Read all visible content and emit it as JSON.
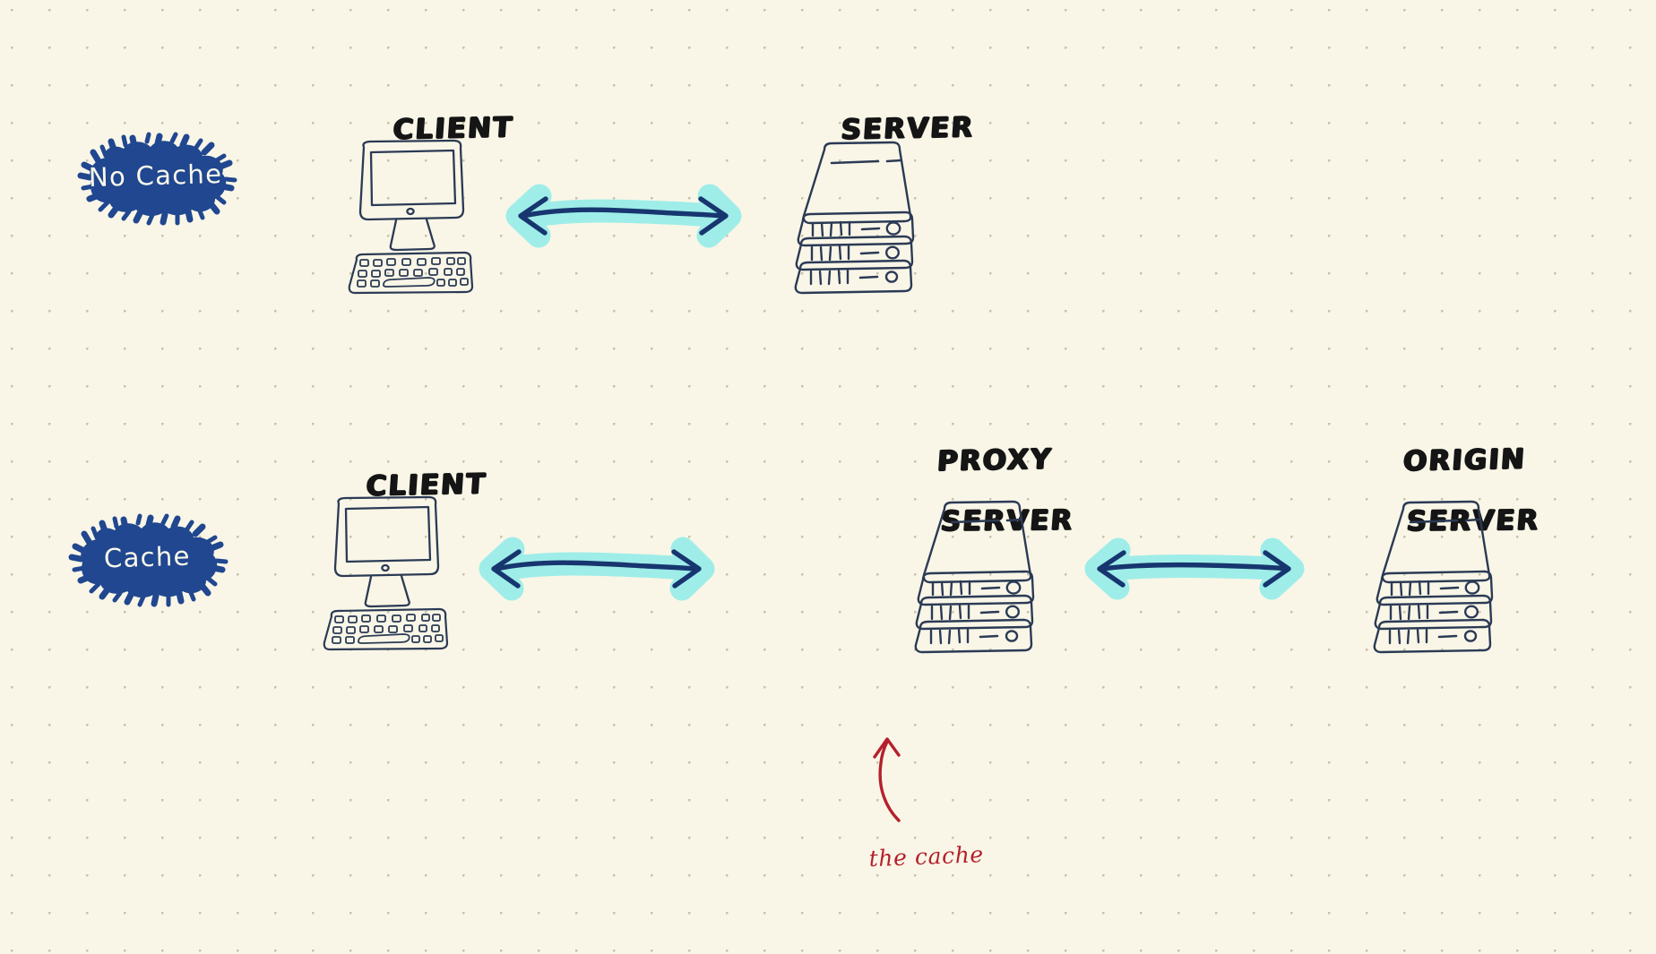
{
  "page": {
    "title": "Cache vs No Cache network diagram",
    "background_color": "#F9F6E7",
    "dot_color": "#C9C3AB"
  },
  "palette": {
    "ink": "#2B3A55",
    "ink_dark": "#1B3A6B",
    "marker_blue": "#20478F",
    "highlight_cyan": "#9FEDE8",
    "arrow_navy": "#17366F",
    "annotation_red": "#B5202C",
    "label_black": "#151515",
    "badge_text": "#FBF9EC"
  },
  "rows": [
    {
      "id": "no-cache",
      "badge": {
        "label": "No Cache",
        "color": "#20478F"
      },
      "nodes": [
        {
          "id": "client",
          "label": "CLIENT",
          "label_line2": "",
          "kind": "computer"
        },
        {
          "id": "server",
          "label": "SERVER",
          "label_line2": "",
          "kind": "server"
        }
      ],
      "links": [
        {
          "id": "client-server",
          "style": "double-arrow-highlight"
        }
      ]
    },
    {
      "id": "cache",
      "badge": {
        "label": "Cache",
        "color": "#20478F"
      },
      "nodes": [
        {
          "id": "client2",
          "label": "CLIENT",
          "label_line2": "",
          "kind": "computer"
        },
        {
          "id": "proxy-server",
          "label": "PROXY",
          "label_line2": "SERVER",
          "kind": "server"
        },
        {
          "id": "origin-server",
          "label": "ORIGIN",
          "label_line2": "SERVER",
          "kind": "server"
        }
      ],
      "links": [
        {
          "id": "client-proxy",
          "style": "double-arrow-highlight"
        },
        {
          "id": "proxy-origin",
          "style": "double-arrow-highlight"
        }
      ],
      "annotation": {
        "text": "the cache",
        "color": "#B5202C",
        "points_to": "proxy-server"
      }
    }
  ]
}
